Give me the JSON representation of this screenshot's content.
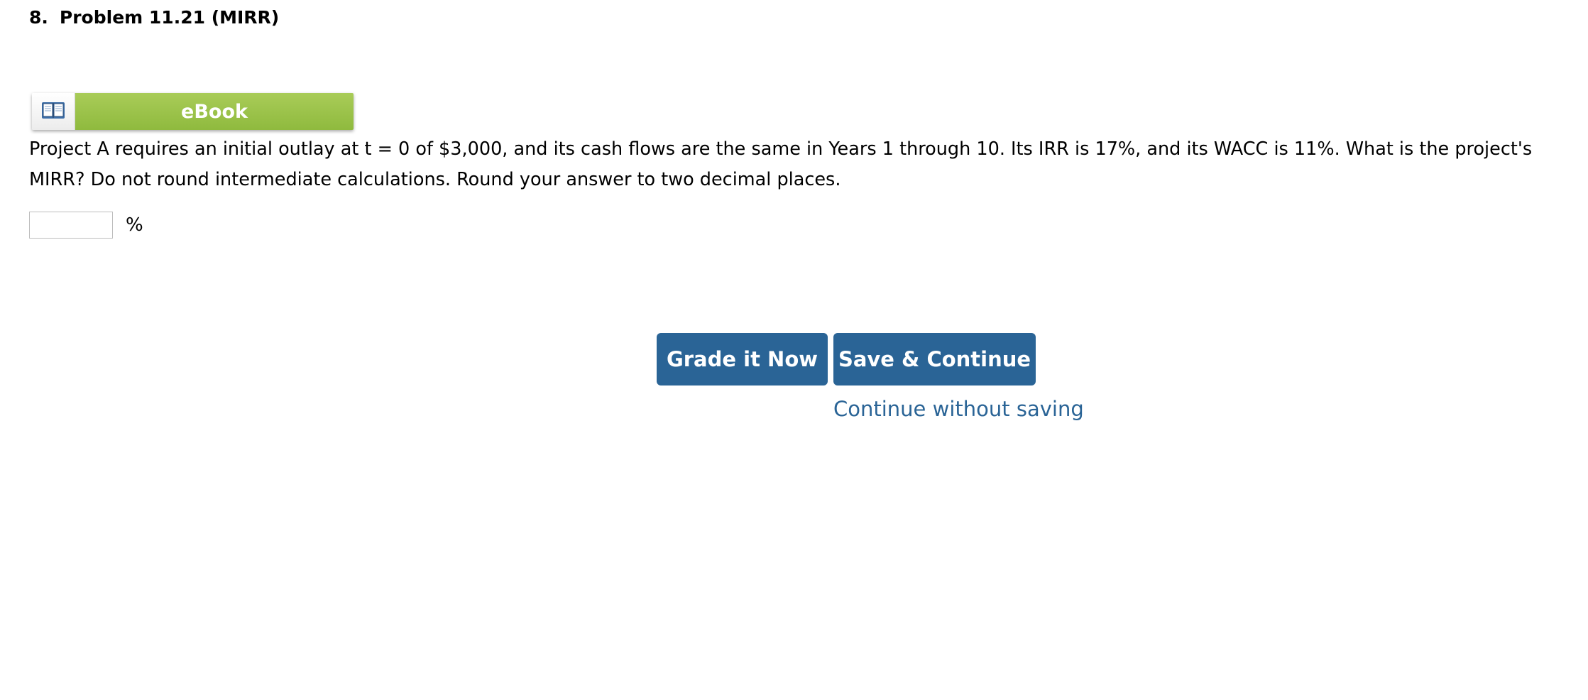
{
  "problem": {
    "number": "8.",
    "title": "Problem 11.21 (MIRR)"
  },
  "ebook": {
    "label": "eBook",
    "icon": "book-icon"
  },
  "question": {
    "text": "Project A requires an initial outlay at t = 0 of $3,000, and its cash flows are the same in Years 1 through 10. Its IRR is 17%, and its WACC is 11%. What is the project's MIRR? Do not round intermediate calculations. Round your answer to two decimal places."
  },
  "answer": {
    "value": "",
    "unit": "%"
  },
  "actions": {
    "grade_label": "Grade it Now",
    "save_label": "Save & Continue",
    "continue_label": "Continue without saving"
  },
  "colors": {
    "button_bg": "#2a6496",
    "link": "#2a6496",
    "ebook_green": "#9dc44b"
  }
}
